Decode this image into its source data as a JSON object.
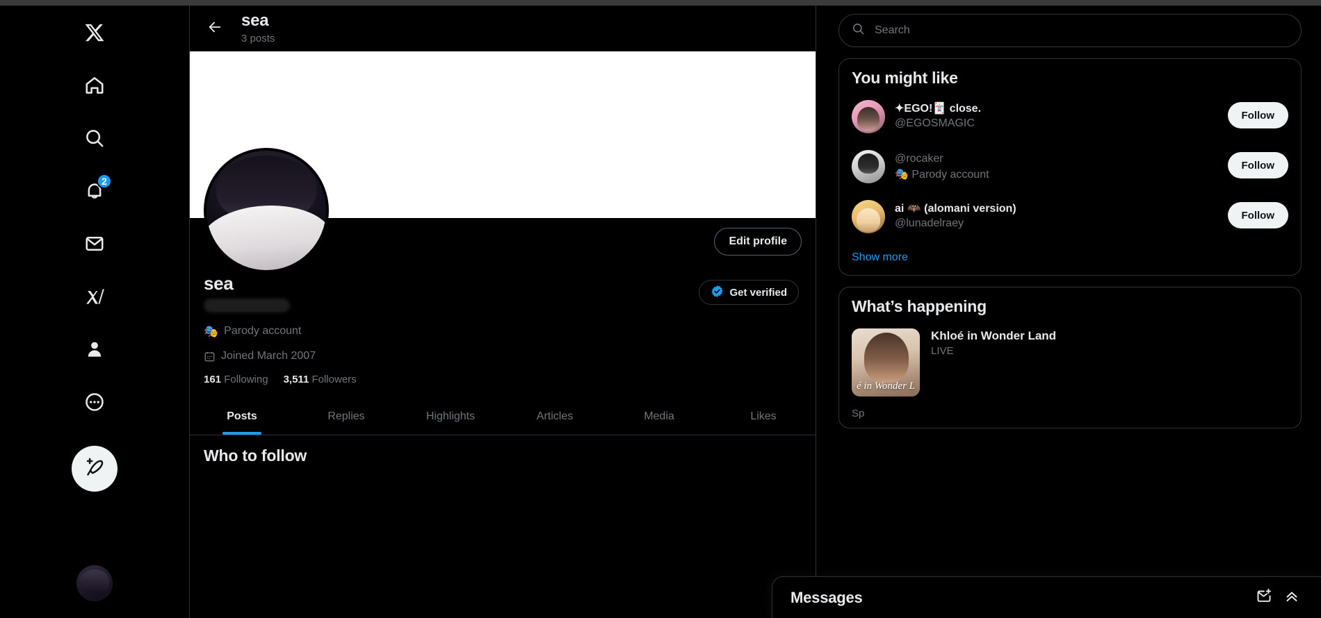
{
  "nav": {
    "items": [
      {
        "name": "x-logo",
        "icon": "x-logo-icon"
      },
      {
        "name": "home",
        "icon": "home-icon"
      },
      {
        "name": "explore",
        "icon": "search-icon"
      },
      {
        "name": "notifications",
        "icon": "bell-icon",
        "badge": "2"
      },
      {
        "name": "messages",
        "icon": "envelope-icon"
      },
      {
        "name": "grok",
        "icon": "grok-icon"
      },
      {
        "name": "profile",
        "icon": "person-icon"
      },
      {
        "name": "more",
        "icon": "more-circle-icon"
      }
    ],
    "compose_icon": "compose-post-icon",
    "account_avatar": "account-avatar"
  },
  "header": {
    "back_icon": "back-arrow-icon",
    "title": "sea",
    "post_count": "3 posts"
  },
  "profile": {
    "display_name": "sea",
    "handle_redacted": true,
    "get_verified_label": "Get verified",
    "verified_badge_color": "#1d9bf0",
    "edit_profile_label": "Edit profile",
    "parody_emoji": "🎭",
    "parody_label": "Parody account",
    "joined_icon": "calendar-icon",
    "joined_label": "Joined March 2007",
    "following_count": "161",
    "following_label": "Following",
    "followers_count": "3,511",
    "followers_label": "Followers"
  },
  "tabs": [
    {
      "label": "Posts",
      "active": true
    },
    {
      "label": "Replies",
      "active": false
    },
    {
      "label": "Highlights",
      "active": false
    },
    {
      "label": "Articles",
      "active": false
    },
    {
      "label": "Media",
      "active": false
    },
    {
      "label": "Likes",
      "active": false
    }
  ],
  "feed": {
    "who_to_follow_heading": "Who to follow"
  },
  "search": {
    "placeholder": "Search",
    "value": "",
    "icon": "search-icon"
  },
  "you_might_like": {
    "title": "You might like",
    "accounts": [
      {
        "name": "✦EGO!🃏 close.",
        "handle": "@EGOSMAGIC",
        "parody": "",
        "follow_label": "Follow",
        "avatar": "art-ego"
      },
      {
        "name": "",
        "handle": "@rocaker",
        "parody": "🎭 Parody account",
        "follow_label": "Follow",
        "avatar": "art-rocaker"
      },
      {
        "name": "ai 🦇 (alomani version)",
        "handle": "@lunadelraey",
        "parody": "",
        "follow_label": "Follow",
        "avatar": "art-luna"
      }
    ],
    "show_more_label": "Show more",
    "link_color": "#1d9bf0"
  },
  "whats_happening": {
    "title": "What’s happening",
    "items": [
      {
        "title": "Khloé in Wonder Land",
        "status": "LIVE",
        "thumb_caption": "é in Wonder L",
        "sponsor_label": "Sp"
      }
    ]
  },
  "messages_dock": {
    "title": "Messages",
    "new_message_icon": "new-message-icon",
    "expand_icon": "chevron-up-icon"
  },
  "colors": {
    "accent": "#1d9bf0",
    "background": "#000000",
    "text_primary": "#e7e9ea",
    "text_secondary": "#71767b",
    "border": "#2f3336"
  }
}
